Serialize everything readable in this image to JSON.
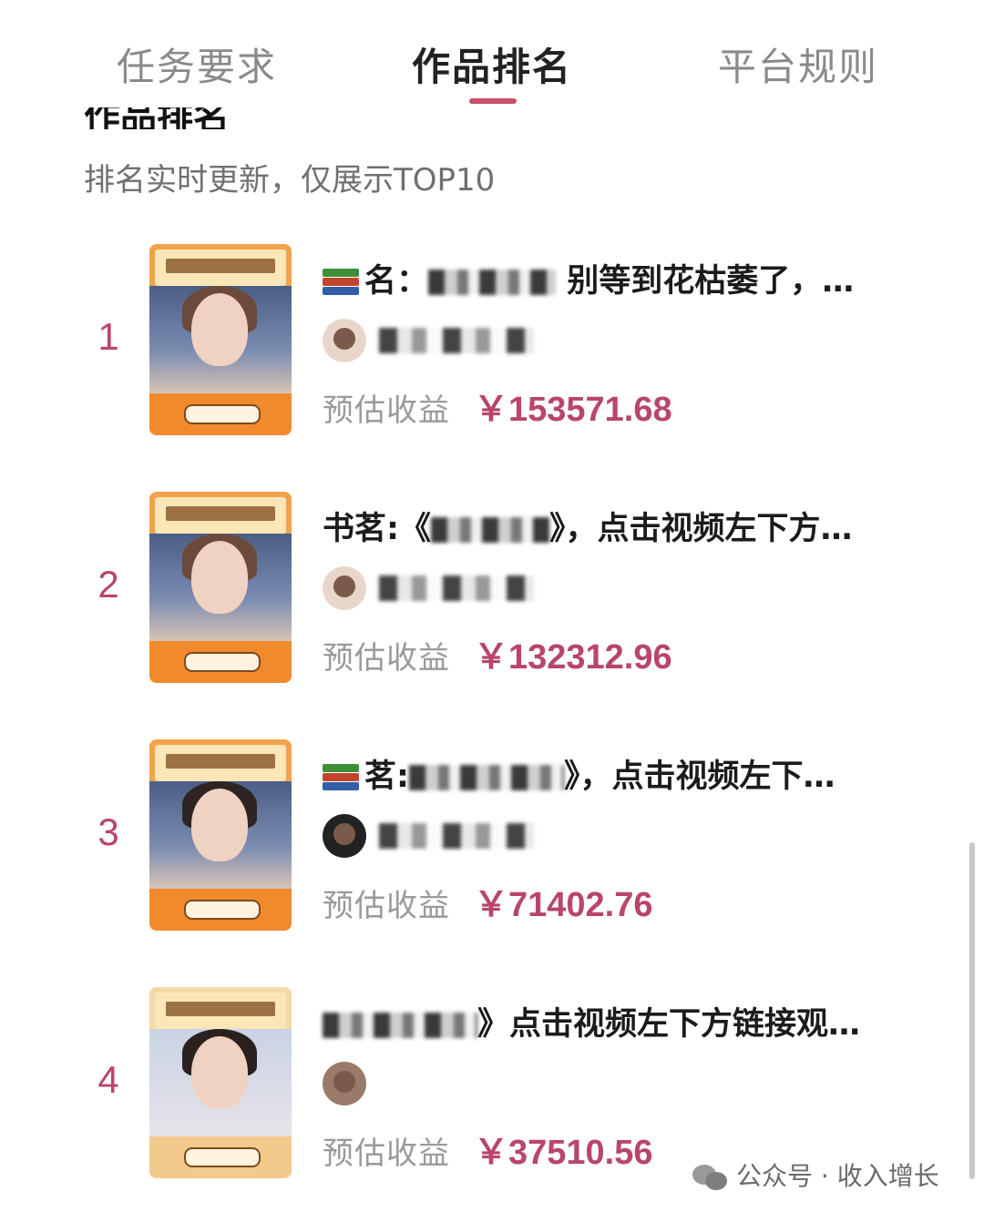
{
  "tabs": [
    {
      "label": "任务要求",
      "active": false
    },
    {
      "label": "作品排名",
      "active": true
    },
    {
      "label": "平台规则",
      "active": false
    }
  ],
  "section": {
    "title": "作品排名",
    "subtitle": "排名实时更新，仅展示TOP10"
  },
  "accent_color": "#b9466a",
  "earn_label": "预估收益",
  "rankings": [
    {
      "rank": "1",
      "title_prefix": "名：",
      "title_suffix": "别等到花枯萎了，…",
      "earnings": "￥153571.68"
    },
    {
      "rank": "2",
      "title_prefix": "书茗:《",
      "title_suffix": "》，点击视频左下方…",
      "earnings": "￥132312.96"
    },
    {
      "rank": "3",
      "title_prefix": "茗:",
      "title_suffix": "》，点击视频左下…",
      "earnings": "￥71402.76"
    },
    {
      "rank": "4",
      "title_prefix": "",
      "title_suffix": "》点击视频左下方链接观…",
      "earnings": "￥37510.56"
    }
  ],
  "watermark": "公众号 · 收入增长"
}
